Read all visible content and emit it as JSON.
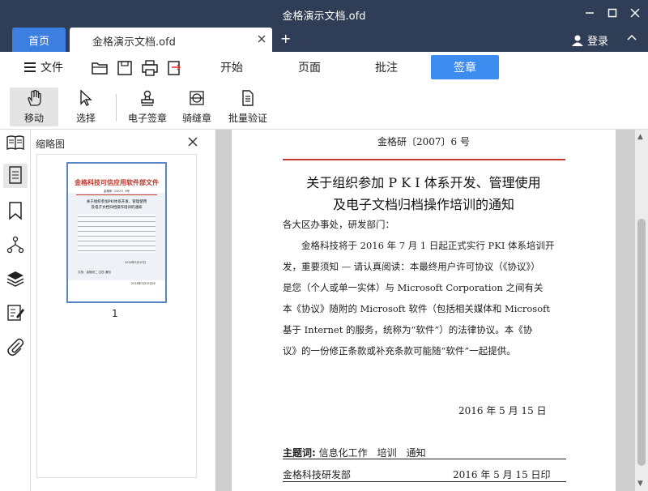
{
  "window": {
    "title": "金格演示文档.ofd"
  },
  "tabs": {
    "home": "首页",
    "doc": "金格演示文档.ofd",
    "add": "+"
  },
  "account": {
    "login": "登录"
  },
  "menu": {
    "file": "文件",
    "tabs": [
      "开始",
      "页面",
      "批注",
      "签章"
    ],
    "active_tab": "签章"
  },
  "ribbon": {
    "items": [
      "移动",
      "选择",
      "电子签章",
      "骑缝章",
      "批量验证"
    ]
  },
  "thumbnail_panel": {
    "title": "缩略图",
    "page_number": "1"
  },
  "thumbnail": {
    "header": "金格科技可信应用软件部文件",
    "doc_no": "金格研〔2007〕6号",
    "title_lines": [
      "关于组织参加PKI体系开发、管理使用",
      "及电子文档归档操作培训的通知"
    ],
    "signature": "文档：金格研二 文档 通知",
    "date_note": "2016年5月15日",
    "print_note": "2016年5月15日印"
  },
  "document": {
    "doc_no": "金格研〔2007〕6 号",
    "title_lines": [
      "关于组织参加 P K I 体系开发、管理使用",
      "及电子文档归档操作培训的通知"
    ],
    "body_lines": [
      "各大区办事处，研发部门：",
      "　　金格科技将于 2016 年 7 月 1 日起正式实行 PKI 体系培训开",
      "发，重要须知 — 请认真阅读：本最终用户许可协议（《协议》）",
      "是您（个人或单一实体）与 Microsoft Corporation 之间有关",
      "本《协议》随附的 Microsoft 软件（包括相关媒体和 Microsoft",
      "基于 Internet 的服务，统称为“软件”）的法律协议。本《协",
      "议》的一份修正条款或补充条款可能随“软件”一起提供。"
    ],
    "date": "2016 年 5 月 15 日",
    "keywords_label": "主题词:",
    "keywords": "信息化工作　培训　通知",
    "footer_left": "金格科技研发部",
    "footer_right": "2016 年 5 月 15 日印"
  }
}
